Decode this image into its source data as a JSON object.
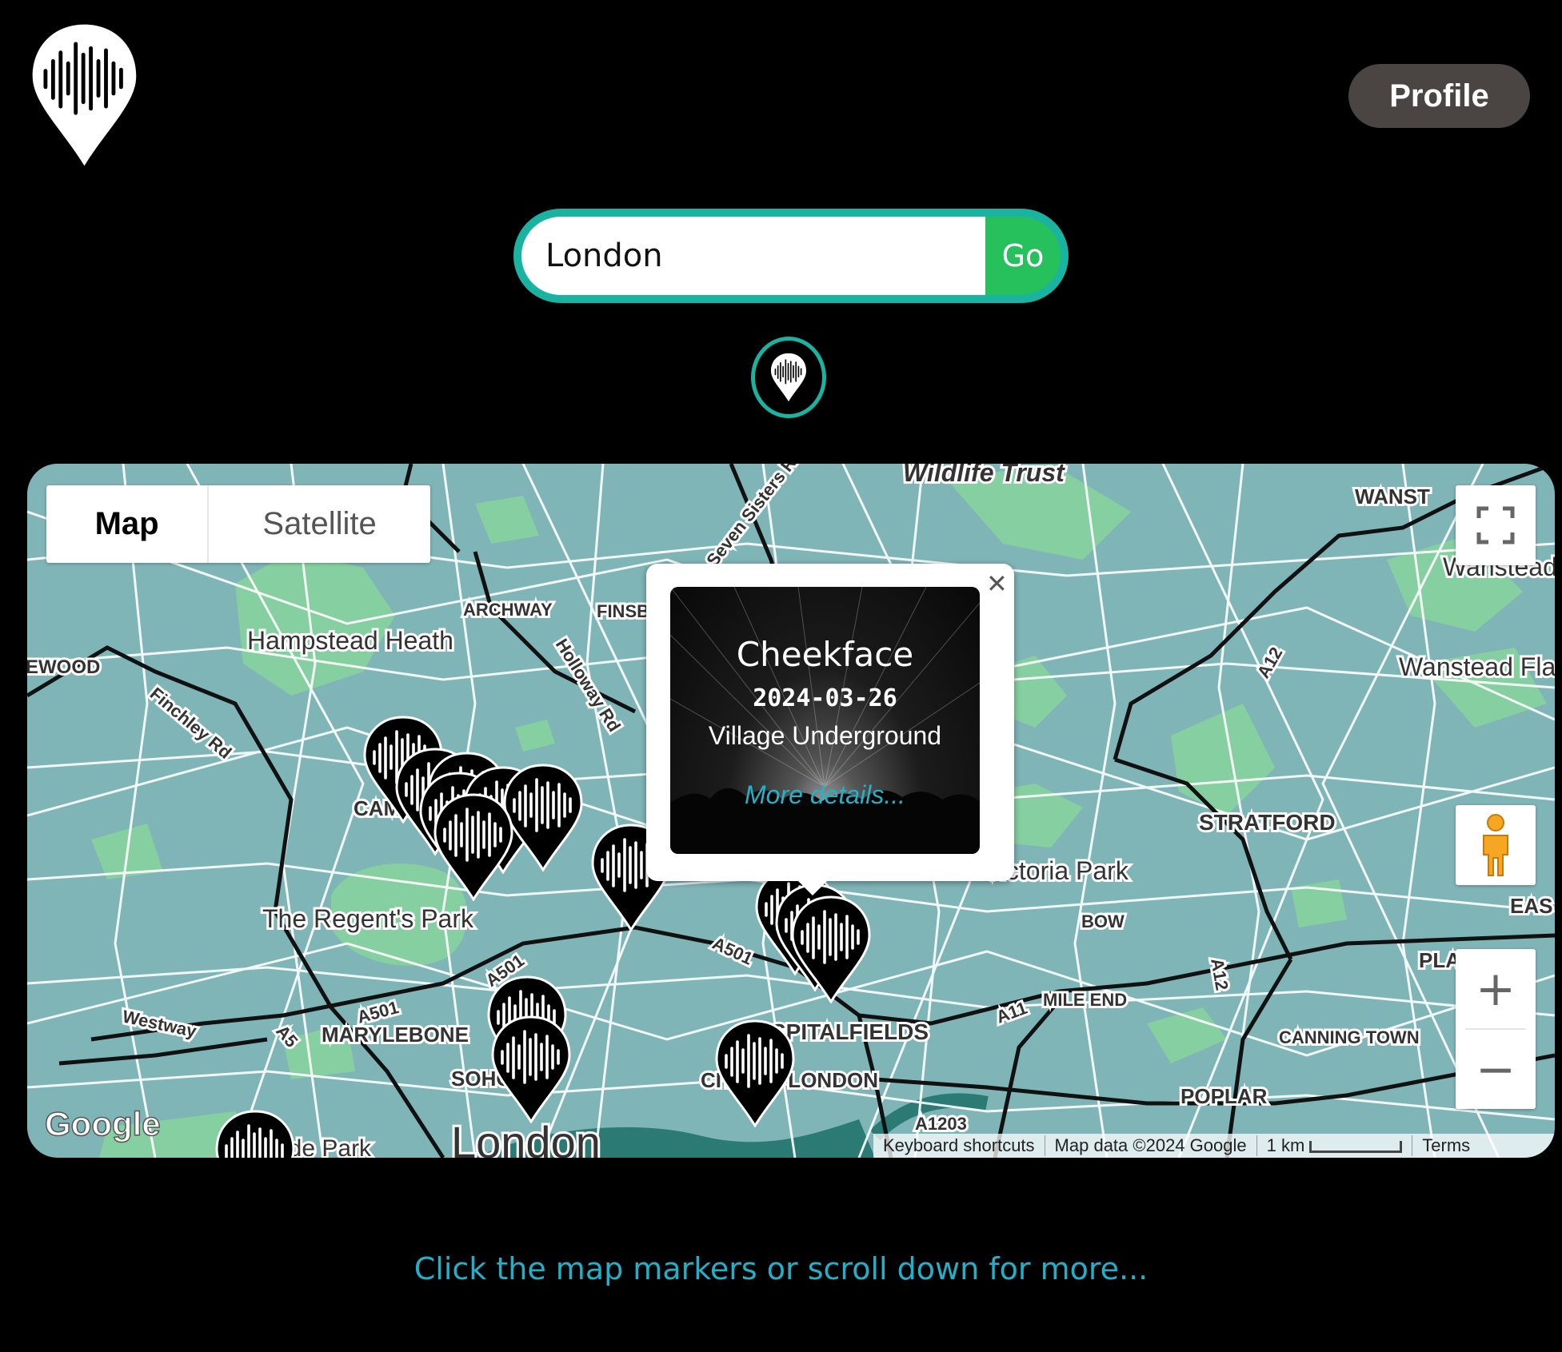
{
  "header": {
    "logo_icon": "map-pin-soundwave-icon",
    "profile_label": "Profile"
  },
  "search": {
    "value": "London",
    "go_label": "Go",
    "locate_icon": "map-pin-soundwave-icon"
  },
  "map": {
    "map_type": {
      "map_label": "Map",
      "satellite_label": "Satellite",
      "selected": "Map"
    },
    "controls": {
      "fullscreen_icon": "fullscreen-icon",
      "street_view_icon": "pegman-icon",
      "zoom_in": "+",
      "zoom_out": "−"
    },
    "attribution": {
      "keyboard": "Keyboard shortcuts",
      "data": "Map data ©2024 Google",
      "scale": "1 km",
      "terms": "Terms"
    },
    "labels": {
      "wildlife_trust": "Wildlife Trust",
      "wanst": "WANST",
      "wanstead": "Wanstead",
      "wanstead_flats": "Wanstead Fla",
      "archway": "ARCHWAY",
      "finsb": "FINSB",
      "hampstead_heath": "Hampstead Heath",
      "ewood": "EWOOD",
      "camden_town": "CAMDEN TOWN",
      "regents_park": "The Regent's Park",
      "marylebone": "MARYLEBONE",
      "soho": "SOHO",
      "city_of_london": "CITY OF LONDON",
      "spitalfields": "SPITALFIELDS",
      "victoria_park": "Victoria Park",
      "bow": "BOW",
      "stratford": "STRATFORD",
      "mile_end": "MILE END",
      "canning_town": "CANNING TOWN",
      "poplar": "POPLAR",
      "plai": "PLAI",
      "eas": "EAS",
      "london": "London",
      "hyde_park": "Hyde Park",
      "westway": "Westway",
      "finchley_rd": "Finchley Rd",
      "holloway_rd": "Holloway Rd",
      "seven_sisters_rd": "Seven Sisters Rd",
      "a501": "A501",
      "a5": "A5",
      "a11": "A11",
      "a12": "A12",
      "a1203": "A1203",
      "google": "Google"
    },
    "marker_icon": "map-pin-soundwave-icon"
  },
  "info_window": {
    "close_icon": "close-icon",
    "event": {
      "title": "Cheekface",
      "date": "2024-03-26",
      "venue": "Village Underground",
      "more_label": "More details..."
    }
  },
  "hint_text": "Click the map markers or scroll down for more..."
}
